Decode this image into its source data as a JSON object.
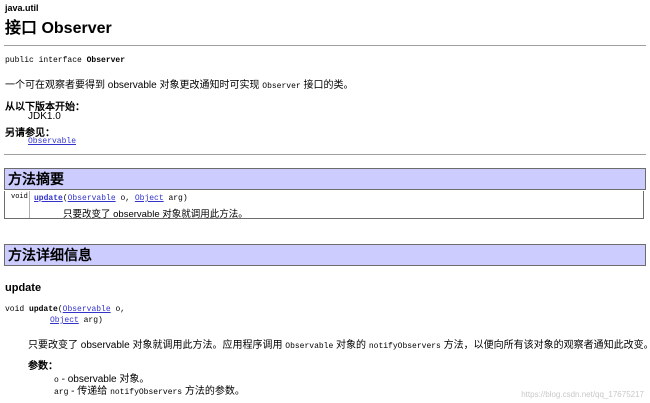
{
  "header": {
    "package": "java.util",
    "title": "接口 Observer"
  },
  "declaration": {
    "prefix": "public interface ",
    "name": "Observer"
  },
  "description": {
    "before": "一个可在观察者要得到 observable 对象更改通知时可实现 ",
    "code": "Observer",
    "after": " 接口的类。"
  },
  "since": {
    "label": "从以下版本开始：",
    "value": "JDK1.0"
  },
  "see_also": {
    "label": "另请参见：",
    "link": "Observable"
  },
  "summary": {
    "heading": "方法摘要",
    "row": {
      "type": "void",
      "method": "update",
      "param1_type": "Observable",
      "param1_name": " o, ",
      "param2_type": "Object",
      "param2_name": " arg)",
      "open_paren": "(",
      "description": "只要改变了 observable 对象就调用此方法。"
    }
  },
  "detail": {
    "heading": "方法详细信息",
    "name": "update",
    "sig_prefix": "void ",
    "sig_method": "update",
    "sig_open": "(",
    "sig_type1": "Observable",
    "sig_name1": " o,",
    "sig_type2": "Object",
    "sig_name2": " arg)",
    "desc_part1": "只要改变了 observable 对象就调用此方法。应用程序调用 ",
    "desc_code1": "Observable",
    "desc_part2": " 对象的 ",
    "desc_code2": "notifyObservers",
    "desc_part3": " 方法，以便向所有该对象的观察者通知此改变。",
    "params_label": "参数：",
    "param1_code": "o",
    "param1_text": " - observable 对象。",
    "param2_code": "arg",
    "param2_text": " - 传递给 ",
    "param2_code2": "notifyObservers",
    "param2_text2": " 方法的参数。"
  },
  "watermark": "https://blog.csdn.net/qq_17675217"
}
